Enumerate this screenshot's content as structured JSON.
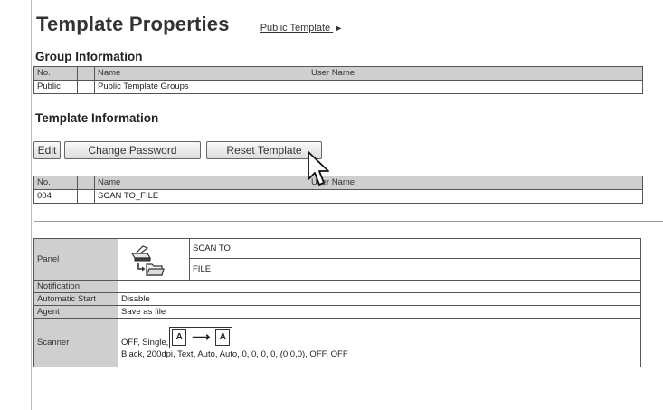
{
  "header": {
    "title": "Template Properties",
    "link": "Public Template",
    "link_arrow": "►"
  },
  "group_info": {
    "heading": "Group Information",
    "columns": [
      "No.",
      "",
      "Name",
      "User Name"
    ],
    "rows": [
      [
        "Public",
        "",
        "Public Template Groups",
        ""
      ]
    ]
  },
  "template_info": {
    "heading": "Template Information",
    "buttons": {
      "edit": "Edit",
      "change_password": "Change Password",
      "reset_template": "Reset Template"
    },
    "columns": [
      "No.",
      "",
      "Name",
      "User Name"
    ],
    "rows": [
      [
        "004",
        "",
        "SCAN TO_FILE",
        ""
      ]
    ]
  },
  "properties": {
    "panel": {
      "label": "Panel",
      "icon": "scan-to-file-icon",
      "line1": "SCAN TO",
      "line2": "FILE"
    },
    "notification": {
      "label": "Notification",
      "value": ""
    },
    "automatic_start": {
      "label": "Automatic Start",
      "value": "Disable"
    },
    "agent": {
      "label": "Agent",
      "value": "Save as file"
    },
    "scanner": {
      "label": "Scanner",
      "line1_prefix": "OFF, Single,",
      "box_left": "A",
      "box_arrow": "⟶",
      "box_right": "A",
      "line2": "Black, 200dpi, Text, Auto, Auto, 0, 0, 0, 0, (0,0,0), OFF, OFF"
    }
  },
  "colors": {
    "header_bg": "#cfcfcf",
    "border": "#555555",
    "text": "#222222"
  }
}
